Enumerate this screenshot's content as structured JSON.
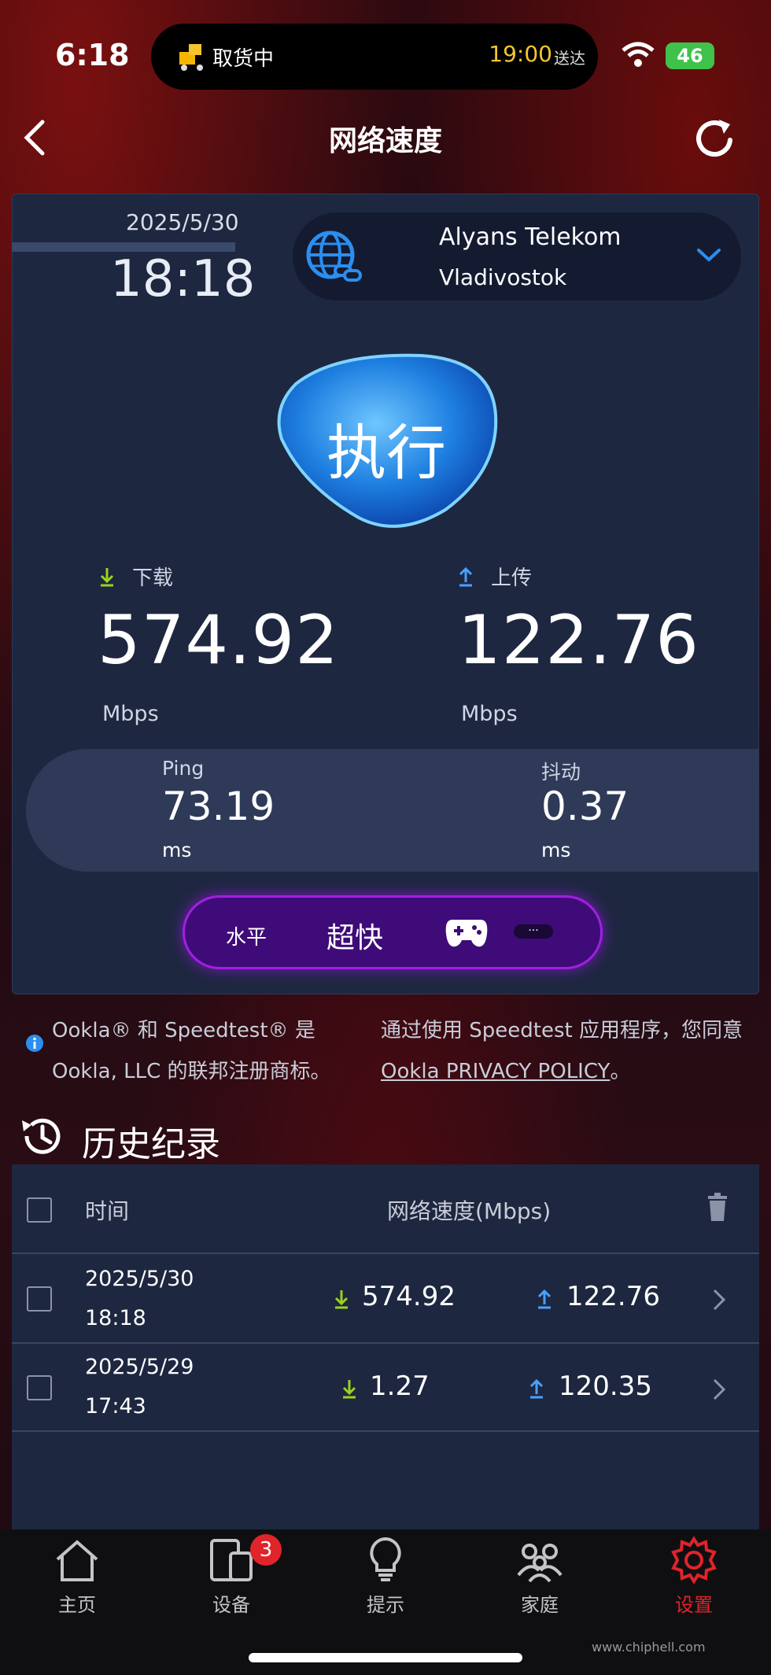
{
  "status_bar": {
    "time": "6:18",
    "island_label": "取货中",
    "island_time": "19:00",
    "island_eta": "送达",
    "battery": "46"
  },
  "header": {
    "title": "网络速度"
  },
  "test": {
    "date": "2025/5/30",
    "time": "18:18",
    "server_name": "Alyans Telekom",
    "server_city": "Vladivostok",
    "run_label": "执行",
    "download_label": "下载",
    "download_value": "574.92",
    "download_unit": "Mbps",
    "upload_label": "上传",
    "upload_value": "122.76",
    "upload_unit": "Mbps",
    "ping_label": "Ping",
    "ping_value": "73.19",
    "ping_unit": "ms",
    "jitter_label": "抖动",
    "jitter_value": "0.37",
    "jitter_unit": "ms",
    "level_label": "水平",
    "level_value": "超快",
    "level_more": "···"
  },
  "notice": {
    "left": "Ookla® 和 Speedtest® 是 Ookla, LLC 的联邦注册商标。",
    "right_prefix": "通过使用 Speedtest 应用程序，您同意",
    "right_link": "Ookla PRIVACY POLICY",
    "right_suffix": "。"
  },
  "history": {
    "title": "历史纪录",
    "col_time": "时间",
    "col_speed": "网络速度(Mbps)",
    "rows": [
      {
        "date": "2025/5/30",
        "time": "18:18",
        "download": "574.92",
        "upload": "122.76"
      },
      {
        "date": "2025/5/29",
        "time": "17:43",
        "download": "1.27",
        "upload": "120.35"
      }
    ]
  },
  "nav": {
    "items": [
      {
        "label": "主页"
      },
      {
        "label": "设备"
      },
      {
        "label": "提示"
      },
      {
        "label": "家庭"
      },
      {
        "label": "设置"
      }
    ],
    "devices_badge": "3"
  },
  "watermark": "www.chiphell.com",
  "colors": {
    "accent": "#2b8ef0",
    "download_arrow": "#9ad21f",
    "upload_arrow": "#4aa0ff",
    "active_nav": "#e0242a",
    "level_purple": "#a020e0"
  }
}
